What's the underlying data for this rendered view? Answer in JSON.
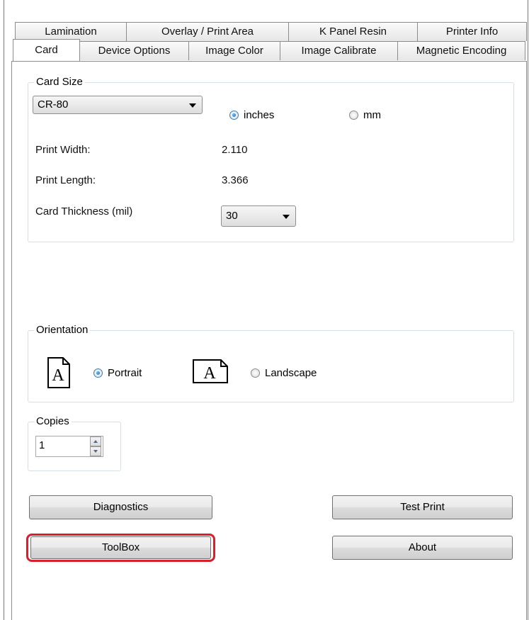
{
  "tabs_back": [
    "Lamination",
    "Overlay / Print Area",
    "K Panel Resin",
    "Printer Info"
  ],
  "tabs_front": [
    "Card",
    "Device Options",
    "Image Color",
    "Image Calibrate",
    "Magnetic Encoding"
  ],
  "selected_tab": "Card",
  "card_size": {
    "legend": "Card Size",
    "selected": "CR-80",
    "units": [
      {
        "label": "inches",
        "checked": true
      },
      {
        "label": "mm",
        "checked": false
      }
    ],
    "print_width_label": "Print Width:",
    "print_width_value": "2.110",
    "print_length_label": "Print Length:",
    "print_length_value": "3.366",
    "thickness_label": "Card Thickness (mil)",
    "thickness_value": "30"
  },
  "orientation": {
    "legend": "Orientation",
    "options": [
      {
        "label": "Portrait",
        "checked": true,
        "glyph": "A"
      },
      {
        "label": "Landscape",
        "checked": false,
        "glyph": "A"
      }
    ]
  },
  "copies": {
    "legend": "Copies",
    "value": "1"
  },
  "buttons": {
    "diagnostics": "Diagnostics",
    "test_print": "Test Print",
    "toolbox": "ToolBox",
    "about": "About"
  },
  "colors": {
    "highlight": "#d6202d",
    "radio_selected": "#0a5fb4"
  }
}
